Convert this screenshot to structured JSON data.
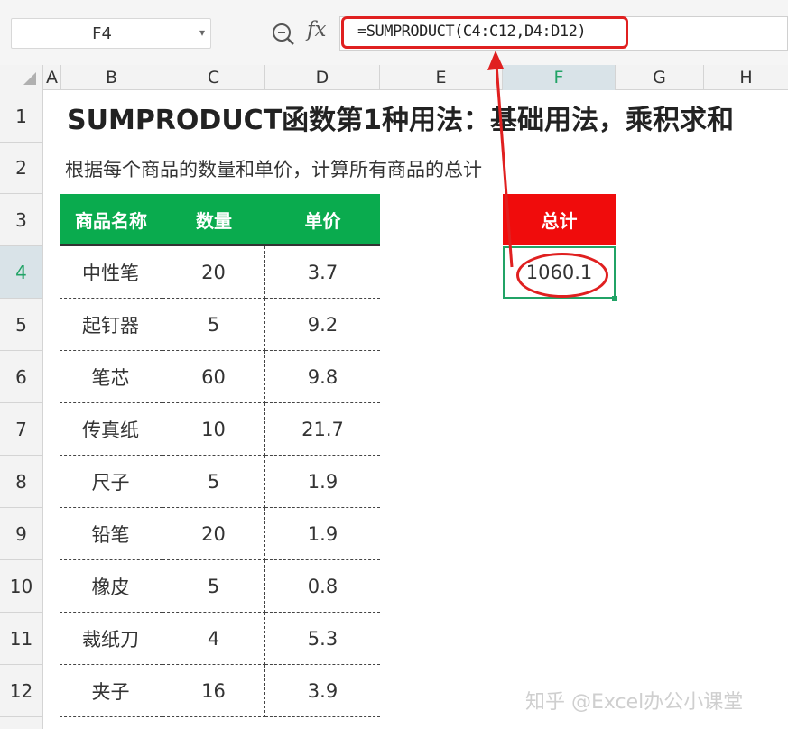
{
  "formula_bar": {
    "name_box": "F4",
    "fx_label": "fx",
    "formula": "=SUMPRODUCT(C4:C12,D4:D12)"
  },
  "columns": [
    "A",
    "B",
    "C",
    "D",
    "E",
    "F",
    "G",
    "H"
  ],
  "rows": [
    "1",
    "2",
    "3",
    "4",
    "5",
    "6",
    "7",
    "8",
    "9",
    "10",
    "11",
    "12"
  ],
  "sheet": {
    "title": "SUMPRODUCT函数第1种用法：基础用法，乘积求和",
    "subtitle": "根据每个商品的数量和单价，计算所有商品的总计",
    "table": {
      "headers": [
        "商品名称",
        "数量",
        "单价"
      ],
      "rows": [
        [
          "中性笔",
          "20",
          "3.7"
        ],
        [
          "起钉器",
          "5",
          "9.2"
        ],
        [
          "笔芯",
          "60",
          "9.8"
        ],
        [
          "传真纸",
          "10",
          "21.7"
        ],
        [
          "尺子",
          "5",
          "1.9"
        ],
        [
          "铅笔",
          "20",
          "1.9"
        ],
        [
          "橡皮",
          "5",
          "0.8"
        ],
        [
          "裁纸刀",
          "4",
          "5.3"
        ],
        [
          "夹子",
          "16",
          "3.9"
        ]
      ]
    },
    "total": {
      "header": "总计",
      "value": "1060.1"
    }
  },
  "watermark": "知乎 @Excel办公小课堂",
  "colors": {
    "table_header": "#0aab4e",
    "total_header": "#f00c0c",
    "selection": "#21a366",
    "annotation": "#e02020"
  },
  "icons": {
    "zoom": "zoom-formula-icon",
    "fx": "fx-icon",
    "dropdown": "chevron-down-icon"
  }
}
